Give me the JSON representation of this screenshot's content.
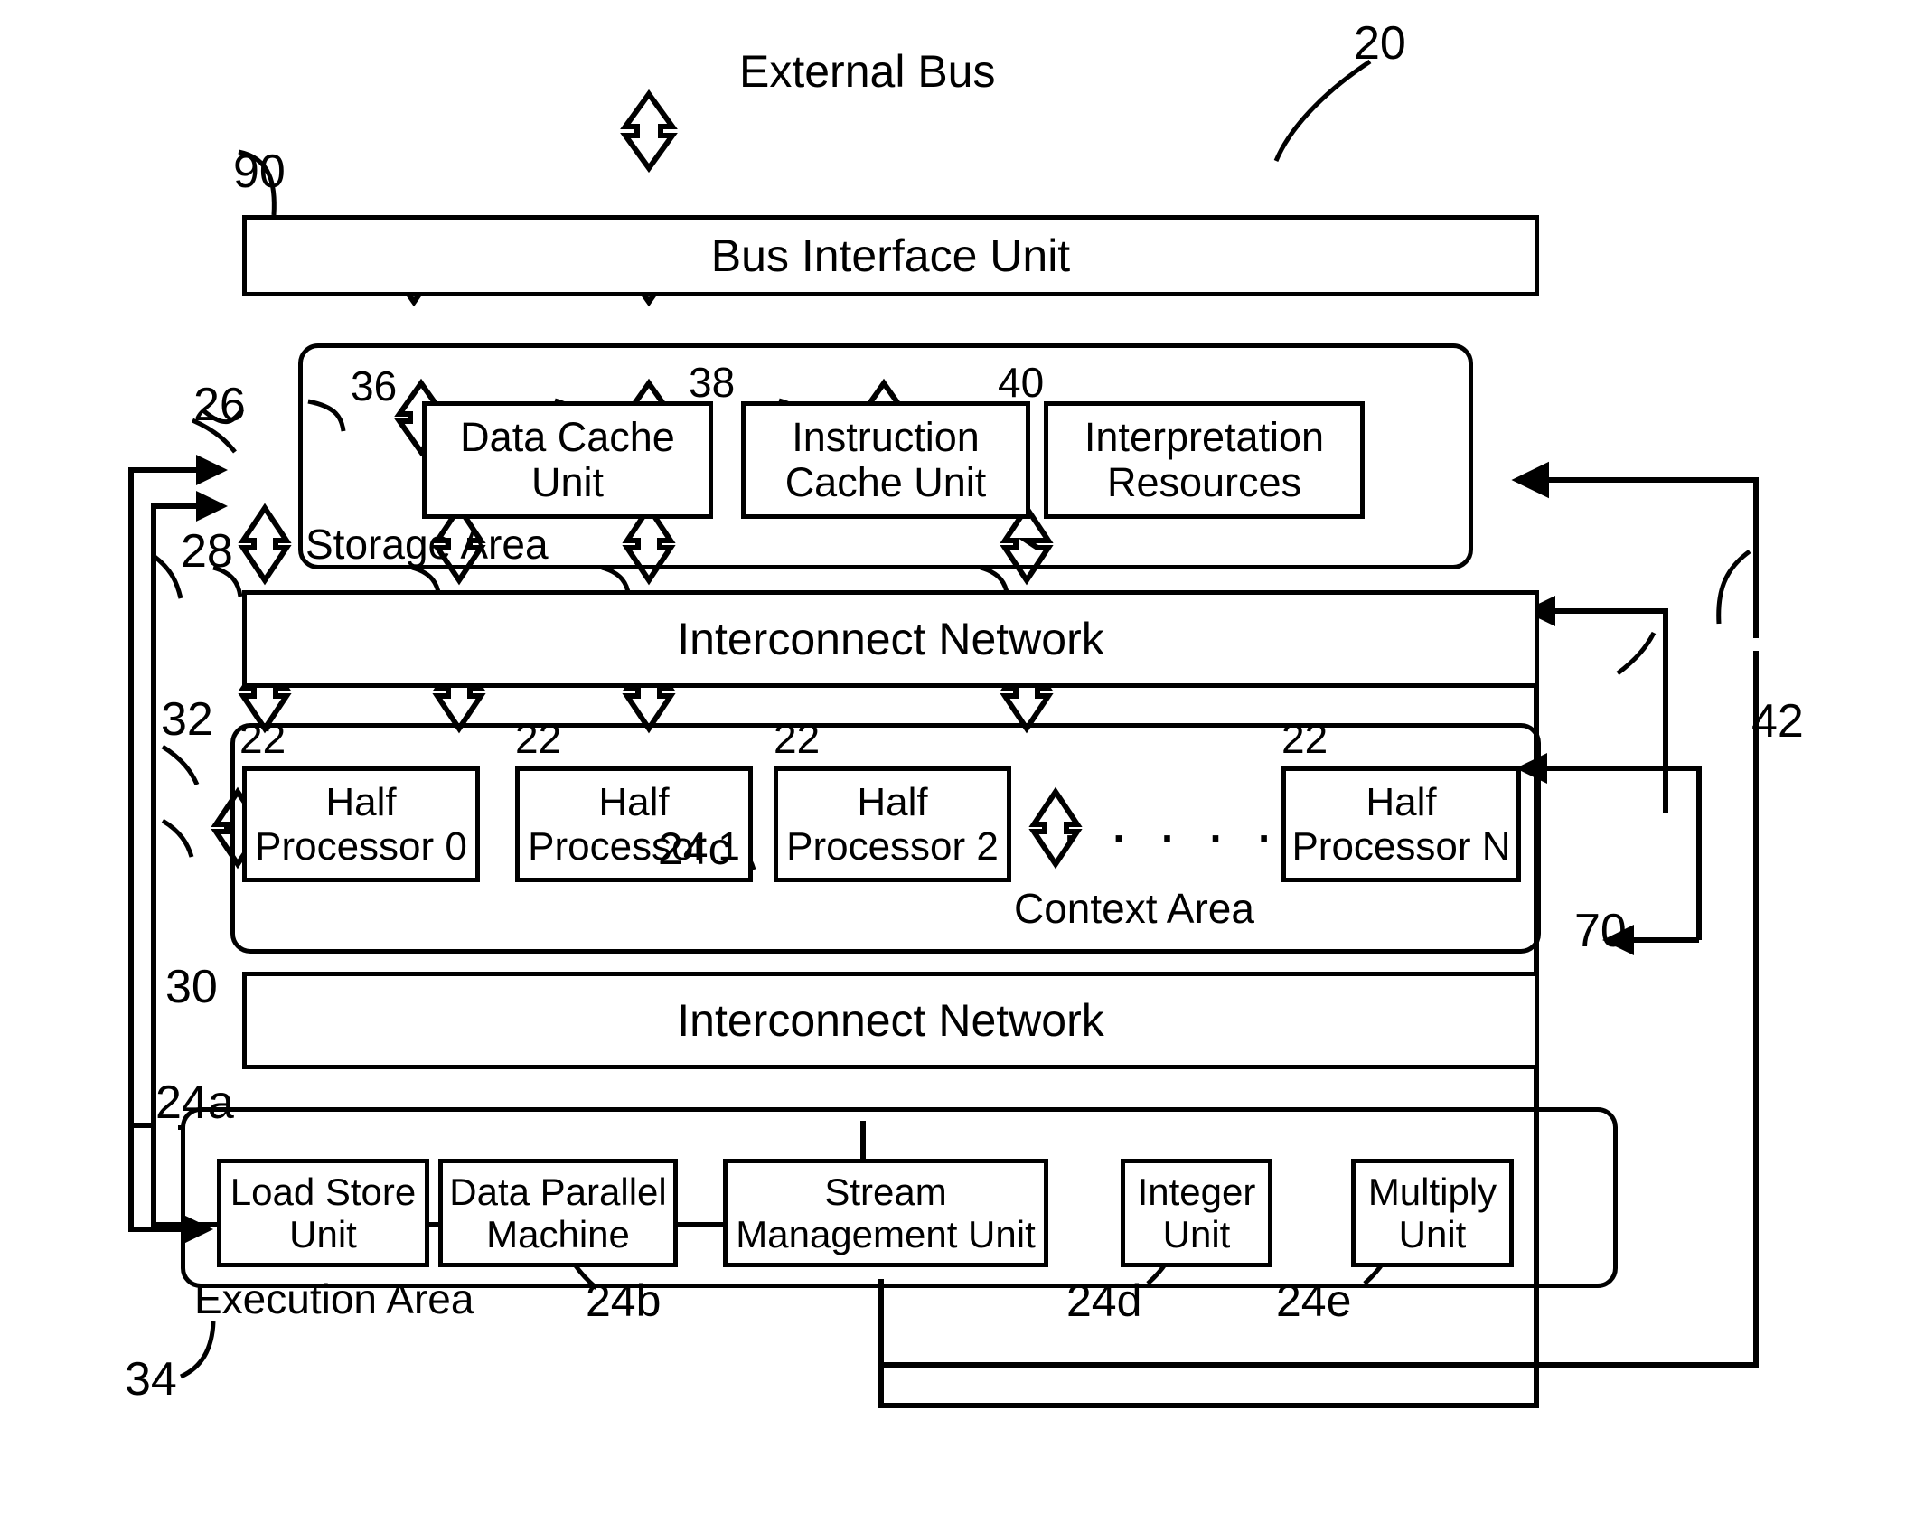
{
  "figure": {
    "top_label": "External Bus",
    "figure_ref": "20"
  },
  "blocks": {
    "bus_interface_unit": {
      "label": "Bus Interface Unit",
      "ref": "90"
    },
    "storage_area": {
      "label": "Storage Area",
      "ref": "26"
    },
    "data_cache_unit": {
      "label": "Data Cache Unit",
      "ref": "36"
    },
    "instruction_cache_unit": {
      "label": "Instruction Cache Unit",
      "ref": "38"
    },
    "interpretation_resources": {
      "label": "Interpretation Resources",
      "ref": "40"
    },
    "interconnect_network_top": {
      "label": "Interconnect Network",
      "ref": "28"
    },
    "context_area": {
      "label": "Context Area",
      "ref": "32"
    },
    "interconnect_network_bottom": {
      "label": "Interconnect Network",
      "ref": "30"
    },
    "execution_area": {
      "label": "Execution Area",
      "ref": "34"
    },
    "bus_right_ref": "42",
    "bus_inner_ref": "70"
  },
  "half_processors": [
    {
      "label": "Half\nProcessor 0",
      "line1": "Half",
      "line2": "Processor 0",
      "ref": "22"
    },
    {
      "label": "Half\nProcessor 1",
      "line1": "Half",
      "line2": "Processor 1",
      "ref": "22"
    },
    {
      "label": "Half\nProcessor 2",
      "line1": "Half",
      "line2": "Processor 2",
      "ref": "22"
    },
    {
      "label": "Half\nProcessor N",
      "line1": "Half",
      "line2": "Processor N",
      "ref": "22"
    }
  ],
  "half_processor_ellipsis": ". . . . .",
  "execution_units": [
    {
      "line1": "Load Store",
      "line2": "Unit",
      "ref": "24a"
    },
    {
      "line1": "Data Parallel",
      "line2": "Machine",
      "ref": "24b"
    },
    {
      "line1": "Stream",
      "line2": "Management Unit",
      "ref": "24c"
    },
    {
      "line1": "Integer",
      "line2": "Unit",
      "ref": "24d"
    },
    {
      "line1": "Multiply",
      "line2": "Unit",
      "ref": "24e"
    }
  ],
  "colors": {
    "ink": "#000000",
    "paper": "#ffffff"
  }
}
